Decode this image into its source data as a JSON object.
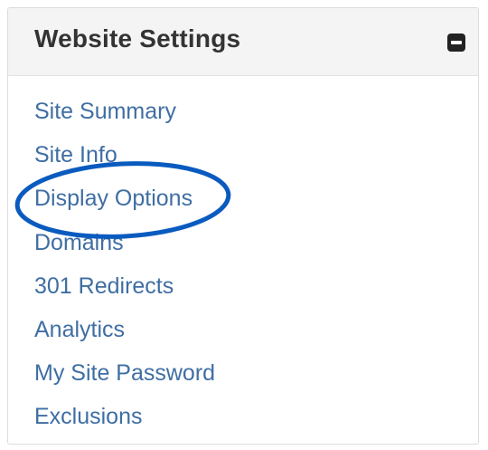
{
  "panel": {
    "title": "Website Settings",
    "collapse_icon": "minus-square-icon",
    "links": [
      {
        "label": "Site Summary"
      },
      {
        "label": "Site Info"
      },
      {
        "label": "Display Options"
      },
      {
        "label": "Domains"
      },
      {
        "label": "301 Redirects"
      },
      {
        "label": "Analytics"
      },
      {
        "label": "My Site Password"
      },
      {
        "label": "Exclusions"
      }
    ]
  },
  "annotation": {
    "highlight_target": "Display Options",
    "highlight_color": "#0a5bbf"
  },
  "colors": {
    "link": "#3f6ea3",
    "title": "#333333",
    "header_bg": "#f4f4f4"
  }
}
